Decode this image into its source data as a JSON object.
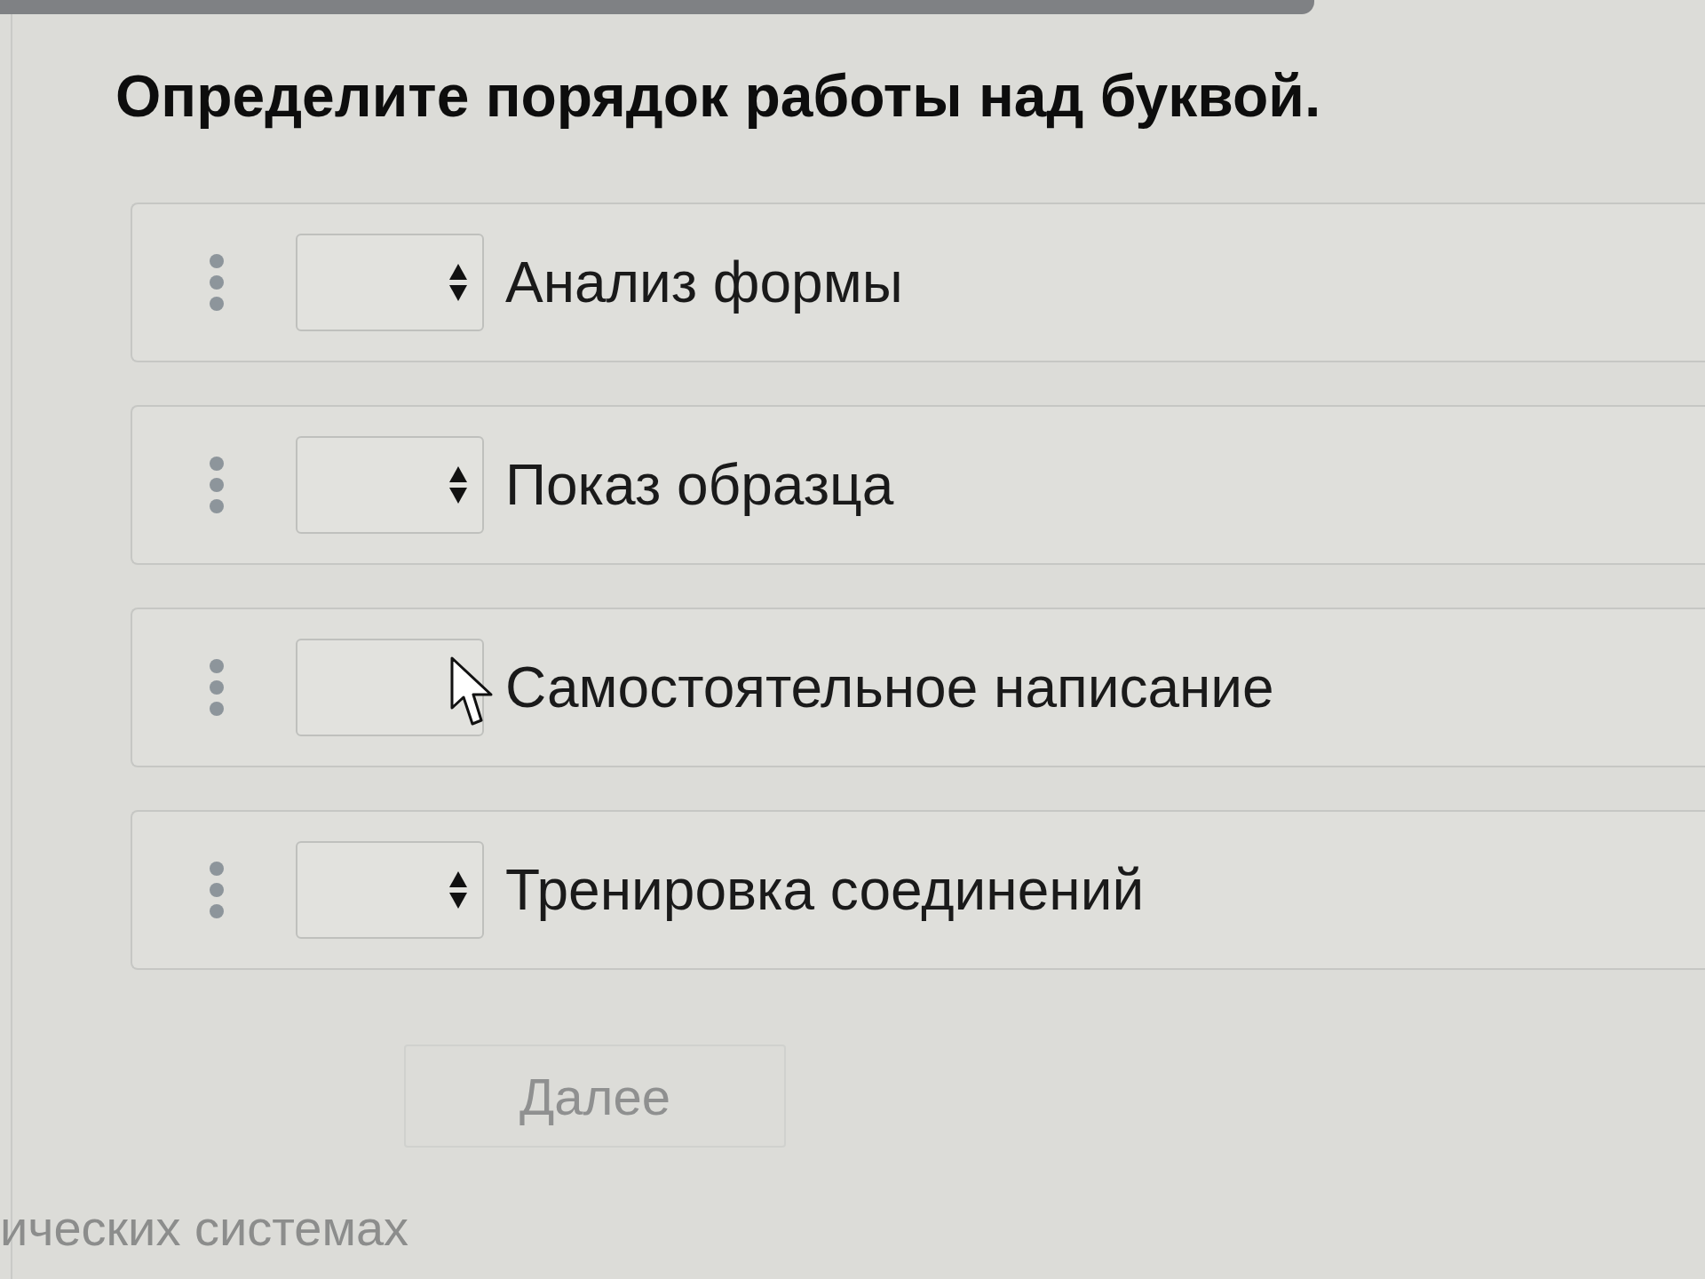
{
  "question": {
    "title": "Определите порядок работы над буквой."
  },
  "items": [
    {
      "label": "Анализ формы",
      "pointer": false
    },
    {
      "label": "Показ образца",
      "pointer": false
    },
    {
      "label": "Самостоятельное написание",
      "pointer": true
    },
    {
      "label": "Тренировка соединений",
      "pointer": false
    }
  ],
  "next_button": {
    "label": "Далее",
    "disabled": true
  },
  "footer": {
    "text": "ических системах"
  }
}
